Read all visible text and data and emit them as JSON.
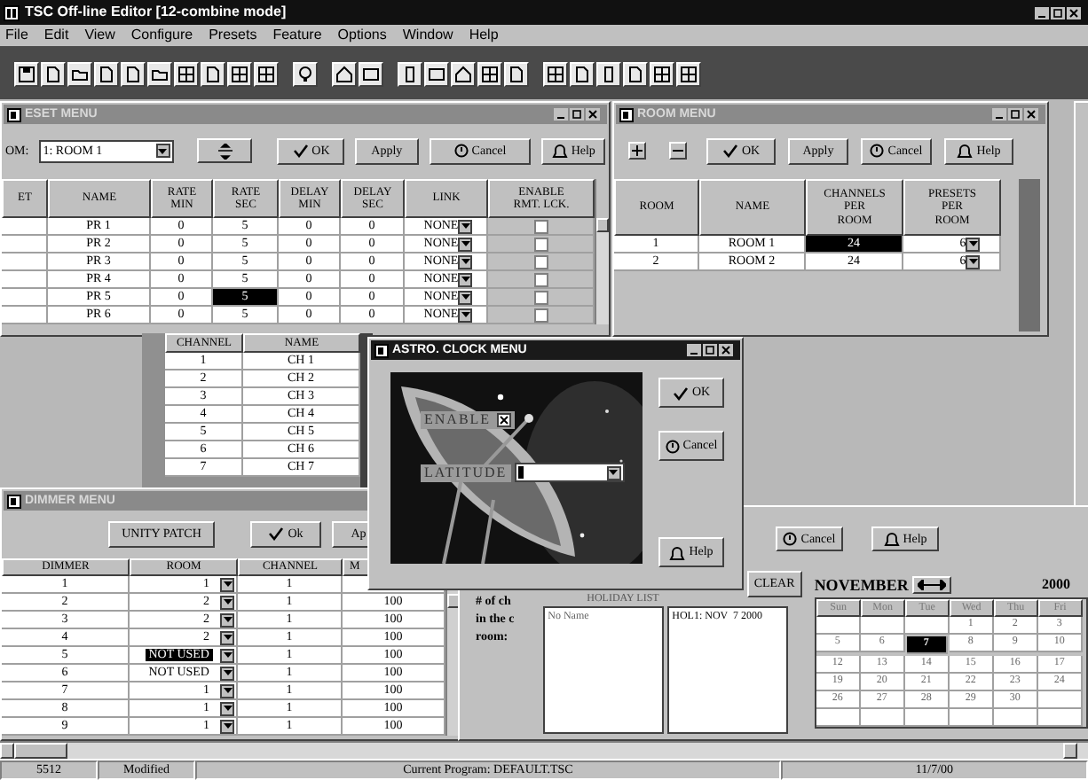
{
  "app": {
    "title": "TSC Off-line Editor [12-combine mode]"
  },
  "menu": [
    "File",
    "Edit",
    "View",
    "Configure",
    "Presets",
    "Feature",
    "Options",
    "Window",
    "Help"
  ],
  "preset_menu": {
    "title": "ESET MENU",
    "active": false,
    "room_label": "OM:",
    "room_select": "1: ROOM 1",
    "buttons": [
      {
        "label": "OK",
        "kind": "check"
      },
      {
        "label": "Apply",
        "kind": "plain"
      },
      {
        "label": "Cancel",
        "kind": "stop"
      },
      {
        "label": "Help",
        "kind": "bell"
      }
    ],
    "columns": [
      "ET",
      "NAME",
      "RATE\nMIN",
      "RATE\nSEC",
      "DELAY\nMIN",
      "DELAY\nSEC",
      "LINK",
      "ENABLE\nRMT. LCK."
    ],
    "rows": [
      {
        "cells": [
          {
            "text": "",
            "selected": false
          },
          {
            "text": "PR 1",
            "selected": false
          },
          {
            "text": "0",
            "selected": false
          },
          {
            "text": "5",
            "selected": false
          },
          {
            "text": "0",
            "selected": false
          },
          {
            "text": "0",
            "selected": false
          }
        ],
        "link": "NONE",
        "rmt_lock": false
      },
      {
        "cells": [
          {
            "text": "",
            "selected": false
          },
          {
            "text": "PR 2",
            "selected": false
          },
          {
            "text": "0",
            "selected": false
          },
          {
            "text": "5",
            "selected": false
          },
          {
            "text": "0",
            "selected": false
          },
          {
            "text": "0",
            "selected": false
          }
        ],
        "link": "NONE",
        "rmt_lock": false
      },
      {
        "cells": [
          {
            "text": "",
            "selected": false
          },
          {
            "text": "PR 3",
            "selected": false
          },
          {
            "text": "0",
            "selected": false
          },
          {
            "text": "5",
            "selected": false
          },
          {
            "text": "0",
            "selected": false
          },
          {
            "text": "0",
            "selected": false
          }
        ],
        "link": "NONE",
        "rmt_lock": false
      },
      {
        "cells": [
          {
            "text": "",
            "selected": false
          },
          {
            "text": "PR 4",
            "selected": false
          },
          {
            "text": "0",
            "selected": false
          },
          {
            "text": "5",
            "selected": false
          },
          {
            "text": "0",
            "selected": false
          },
          {
            "text": "0",
            "selected": false
          }
        ],
        "link": "NONE",
        "rmt_lock": false
      },
      {
        "cells": [
          {
            "text": "",
            "selected": false
          },
          {
            "text": "PR 5",
            "selected": false
          },
          {
            "text": "0",
            "selected": false
          },
          {
            "text": "5",
            "selected": true
          },
          {
            "text": "0",
            "selected": false
          },
          {
            "text": "0",
            "selected": false
          }
        ],
        "link": "NONE",
        "rmt_lock": false
      },
      {
        "cells": [
          {
            "text": "",
            "selected": false
          },
          {
            "text": "PR 6",
            "selected": false
          },
          {
            "text": "0",
            "selected": false
          },
          {
            "text": "5",
            "selected": false
          },
          {
            "text": "0",
            "selected": false
          },
          {
            "text": "0",
            "selected": false
          }
        ],
        "link": "NONE",
        "rmt_lock": false
      }
    ]
  },
  "room_menu": {
    "title": "ROOM MENU",
    "active": false,
    "buttons": [
      {
        "label": "OK",
        "kind": "check"
      },
      {
        "label": "Apply",
        "kind": "plain"
      },
      {
        "label": "Cancel",
        "kind": "stop"
      },
      {
        "label": "Help",
        "kind": "bell"
      }
    ],
    "columns": [
      "ROOM",
      "NAME",
      "CHANNELS\nPER\nROOM",
      "PRESETS\nPER\nROOM"
    ],
    "rows": [
      {
        "cells": [
          {
            "text": "1",
            "selected": false
          },
          {
            "text": "ROOM 1",
            "selected": false
          },
          {
            "text": "24",
            "selected": true
          },
          {
            "text": "6",
            "selected": false
          }
        ]
      },
      {
        "cells": [
          {
            "text": "2",
            "selected": false
          },
          {
            "text": "ROOM 2",
            "selected": false
          },
          {
            "text": "24",
            "selected": false
          },
          {
            "text": "6",
            "selected": false
          }
        ]
      }
    ]
  },
  "channel_table": {
    "columns": [
      "CHANNEL",
      "NAME"
    ],
    "rows": [
      {
        "channel": "1",
        "name": "CH  1"
      },
      {
        "channel": "2",
        "name": "CH  2"
      },
      {
        "channel": "3",
        "name": "CH  3"
      },
      {
        "channel": "4",
        "name": "CH  4"
      },
      {
        "channel": "5",
        "name": "CH  5"
      },
      {
        "channel": "6",
        "name": "CH  6"
      },
      {
        "channel": "7",
        "name": "CH  7"
      }
    ]
  },
  "dimmer_menu": {
    "title": "DIMMER MENU",
    "active": false,
    "buttons": [
      {
        "label": "UNITY PATCH",
        "kind": "plain"
      },
      {
        "label": "Ok",
        "kind": "check"
      },
      {
        "label": "Ap",
        "kind": "plain"
      }
    ],
    "columns": [
      "DIMMER",
      "ROOM",
      "CHANNEL",
      "M"
    ],
    "rows": [
      {
        "cells": [
          {
            "text": "1",
            "selected": false
          },
          {
            "text": "1",
            "selected": false
          },
          {
            "text": "1",
            "selected": false
          }
        ]
      },
      {
        "cells": [
          {
            "text": "2",
            "selected": false
          },
          {
            "text": "2",
            "selected": false
          },
          {
            "text": "1",
            "selected": false
          },
          {
            "text": "100",
            "selected": false
          }
        ]
      },
      {
        "cells": [
          {
            "text": "3",
            "selected": false
          },
          {
            "text": "2",
            "selected": false
          },
          {
            "text": "1",
            "selected": false
          },
          {
            "text": "100",
            "selected": false
          }
        ]
      },
      {
        "cells": [
          {
            "text": "4",
            "selected": false
          },
          {
            "text": "2",
            "selected": false
          },
          {
            "text": "1",
            "selected": false
          },
          {
            "text": "100",
            "selected": false
          }
        ]
      },
      {
        "cells": [
          {
            "text": "5",
            "selected": false
          },
          {
            "text": "NOT USED",
            "selected": true
          },
          {
            "text": "1",
            "selected": false
          },
          {
            "text": "100",
            "selected": false
          }
        ]
      },
      {
        "cells": [
          {
            "text": "6",
            "selected": false
          },
          {
            "text": "NOT USED",
            "selected": false
          },
          {
            "text": "1",
            "selected": false
          },
          {
            "text": "100",
            "selected": false
          }
        ]
      },
      {
        "cells": [
          {
            "text": "7",
            "selected": false
          },
          {
            "text": "1",
            "selected": false
          },
          {
            "text": "1",
            "selected": false
          },
          {
            "text": "100",
            "selected": false
          }
        ]
      },
      {
        "cells": [
          {
            "text": "8",
            "selected": false
          },
          {
            "text": "1",
            "selected": false
          },
          {
            "text": "1",
            "selected": false
          },
          {
            "text": "100",
            "selected": false
          }
        ]
      },
      {
        "cells": [
          {
            "text": "9",
            "selected": false
          },
          {
            "text": "1",
            "selected": false
          },
          {
            "text": "1",
            "selected": false
          },
          {
            "text": "100",
            "selected": false
          }
        ]
      }
    ]
  },
  "holiday_window": {
    "buttons": [
      {
        "label": "Cancel",
        "kind": "stop"
      },
      {
        "label": "Help",
        "kind": "bell"
      }
    ],
    "info_lines": [
      "# of ch",
      "in the c",
      "room:"
    ],
    "clear_button": "CLEAR",
    "list_title": "HOLIDAY LIST",
    "names": [
      "No Name"
    ],
    "dates": [
      "HOL1: NOV  7 2000"
    ],
    "calendar": {
      "month": "NOVEMBER",
      "year": "2000",
      "days": [
        "Sun",
        "Mon",
        "Tue",
        "Wed",
        "Thu",
        "Fri"
      ],
      "weeks": [
        [
          {
            "selected": false
          },
          {
            "selected": false
          },
          {
            "selected": false
          },
          {
            "day": "1",
            "selected": false
          },
          {
            "day": "2",
            "selected": false
          },
          {
            "day": "3",
            "selected": false
          }
        ],
        [
          {
            "day": "5",
            "selected": false
          },
          {
            "day": "6",
            "selected": false
          },
          {
            "day": "7",
            "selected": true
          },
          {
            "day": "8",
            "selected": false
          },
          {
            "day": "9",
            "selected": false
          },
          {
            "day": "10",
            "selected": false
          }
        ],
        [
          {
            "day": "12",
            "selected": false
          },
          {
            "day": "13",
            "selected": false
          },
          {
            "day": "14",
            "selected": false
          },
          {
            "day": "15",
            "selected": false
          },
          {
            "day": "16",
            "selected": false
          },
          {
            "day": "17",
            "selected": false
          }
        ],
        [
          {
            "day": "19",
            "selected": false
          },
          {
            "day": "20",
            "selected": false
          },
          {
            "day": "21",
            "selected": false
          },
          {
            "day": "22",
            "selected": false
          },
          {
            "day": "23",
            "selected": false
          },
          {
            "day": "24",
            "selected": false
          }
        ],
        [
          {
            "day": "26",
            "selected": false
          },
          {
            "day": "27",
            "selected": false
          },
          {
            "day": "28",
            "selected": false
          },
          {
            "day": "29",
            "selected": false
          },
          {
            "day": "30",
            "selected": false
          },
          {
            "selected": false
          }
        ],
        [
          {
            "selected": false
          },
          {
            "selected": false
          },
          {
            "selected": false
          },
          {
            "selected": false
          },
          {
            "selected": false
          },
          {
            "selected": false
          }
        ]
      ]
    }
  },
  "astro_clock_menu": {
    "title": "ASTRO. CLOCK MENU",
    "active": true,
    "enable_label": "ENABLE",
    "enable_checked": true,
    "latitude_label": "LATITUDE",
    "buttons": [
      {
        "label": "OK",
        "kind": "check"
      },
      {
        "label": "Cancel",
        "kind": "stop"
      },
      {
        "label": "Help",
        "kind": "bell"
      }
    ]
  },
  "status_bar": [
    "5512",
    "Modified",
    "Current Program: DEFAULT.TSC",
    "11/7/00"
  ]
}
